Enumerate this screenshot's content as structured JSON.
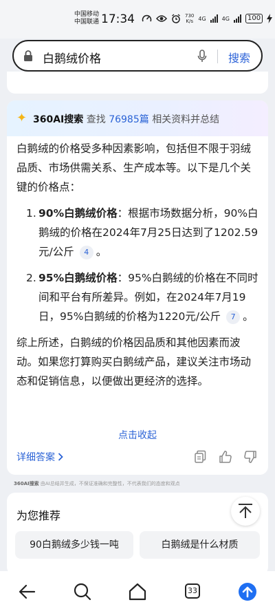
{
  "status_bar": {
    "carrier1": "中国移动",
    "carrier2": "中国联通",
    "time": "17:34",
    "speed_value": "730",
    "speed_unit": "K/s",
    "net1": "4G",
    "net2": "4G",
    "battery": "100"
  },
  "search": {
    "query": "白鹅绒价格",
    "button_label": "搜索"
  },
  "ai_answer": {
    "brand": "360AI搜索",
    "find_label": "查找",
    "count": "76985篇",
    "suffix": "相关资料并总结",
    "intro": "白鹅绒的价格受多种因素影响，包括但不限于羽绒品质、市场供需关系、生产成本等。以下是几个关键的价格点：",
    "items": [
      {
        "num": "1.",
        "heading": "90%白鹅绒价格",
        "text": "：根据市场数据分析，90%白鹅绒的价格在2024年7月25日达到了1202.59元/公斤",
        "cite": "4",
        "tail": "。"
      },
      {
        "num": "2.",
        "heading": "95%白鹅绒价格",
        "text": "：95%白鹅绒的价格在不同时间和平台有所差异。例如，在2024年7月19日，95%白鹅绒的价格为1220元/公斤",
        "cite": "7",
        "tail": "。"
      }
    ],
    "summary": "综上所述，白鹅绒的价格因品质和其他因素而波动。如果您打算购买白鹅绒产品，建议关注市场动态和促销信息，以便做出更经济的选择。",
    "collapse_label": "点击收起",
    "detail_label": "详细答案"
  },
  "disclaimer": {
    "brand": "360AI搜索",
    "text": "由AI总结并生成，不保证准确和完整性，不代表我们的态度和观点"
  },
  "recommend": {
    "title": "为您推荐",
    "chips": [
      "90白鹅绒多少钱一吨",
      "白鹅绒是什么材质"
    ]
  },
  "nav": {
    "tabs_count": "33"
  },
  "colors": {
    "accent": "#2b63d6",
    "home_icon": "#1f6ff2"
  }
}
